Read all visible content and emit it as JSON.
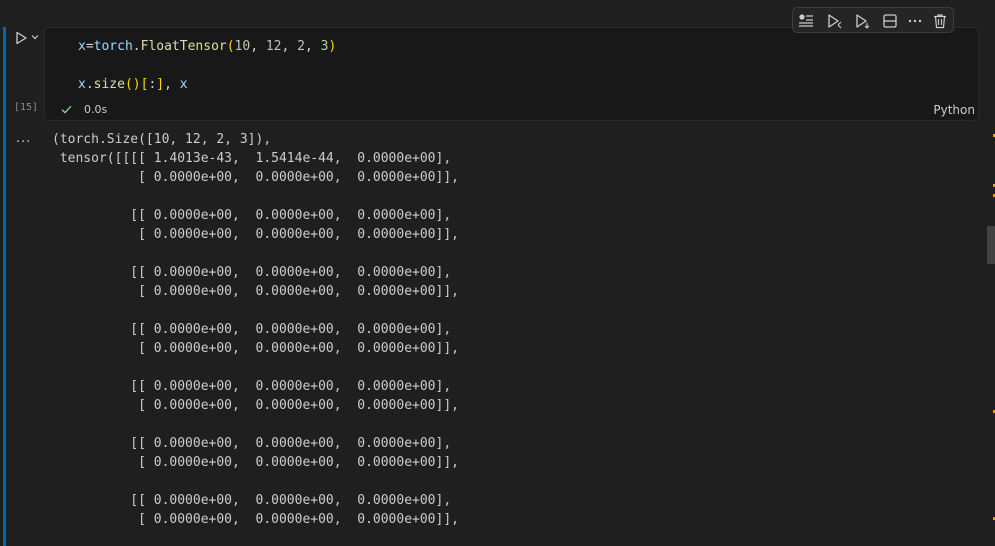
{
  "cell": {
    "execution_count": "[15]",
    "status_time": "0.0s",
    "language": "Python",
    "code": {
      "line1": {
        "var": "x",
        "eq": "=",
        "mod": "torch",
        "dot": ".",
        "fn": "FloatTensor",
        "open": "(",
        "a": "10",
        "c1": ", ",
        "b": "12",
        "c2": ", ",
        "c": "2",
        "c3": ", ",
        "d": "3",
        "close": ")"
      },
      "line2": {
        "var": "x",
        "dot": ".",
        "fn": "size",
        "p1": "(",
        "p2": ")",
        "br1": "[",
        "slice": ":",
        "br2": "]",
        "rest": ", ",
        "var2": "x"
      }
    }
  },
  "toolbar": {
    "items": [
      {
        "icon": "run-by-line-icon"
      },
      {
        "icon": "execute-above-icon"
      },
      {
        "icon": "execute-below-icon"
      },
      {
        "icon": "split-cell-icon"
      },
      {
        "icon": "more-actions-icon"
      },
      {
        "icon": "delete-icon"
      }
    ]
  },
  "output": {
    "more_label": "...",
    "text": "(torch.Size([10, 12, 2, 3]),\n tensor([[[[ 1.4013e-43,  1.5414e-44,  0.0000e+00],\n           [ 0.0000e+00,  0.0000e+00,  0.0000e+00]],\n\n          [[ 0.0000e+00,  0.0000e+00,  0.0000e+00],\n           [ 0.0000e+00,  0.0000e+00,  0.0000e+00]],\n\n          [[ 0.0000e+00,  0.0000e+00,  0.0000e+00],\n           [ 0.0000e+00,  0.0000e+00,  0.0000e+00]],\n\n          [[ 0.0000e+00,  0.0000e+00,  0.0000e+00],\n           [ 0.0000e+00,  0.0000e+00,  0.0000e+00]],\n\n          [[ 0.0000e+00,  0.0000e+00,  0.0000e+00],\n           [ 0.0000e+00,  0.0000e+00,  0.0000e+00]],\n\n          [[ 0.0000e+00,  0.0000e+00,  0.0000e+00],\n           [ 0.0000e+00,  0.0000e+00,  0.0000e+00]],\n\n          [[ 0.0000e+00,  0.0000e+00,  0.0000e+00],\n           [ 0.0000e+00,  0.0000e+00,  0.0000e+00]],"
  },
  "colors": {
    "background": "#1f1f1f",
    "focus_bar": "#0a64b4",
    "check": "#89d185"
  }
}
